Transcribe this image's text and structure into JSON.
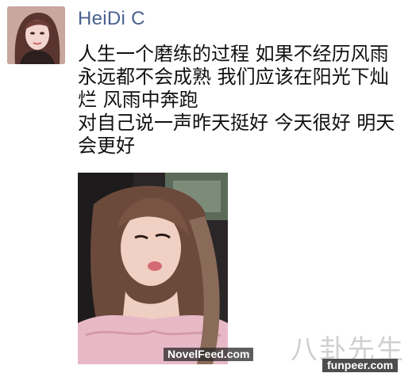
{
  "post": {
    "author": "HeiDi C",
    "text_lines": [
      "人生一个磨练的过程  如果不经历风雨",
      "永远都不会成熟  我们应该在阳光下灿",
      "烂  风雨中奔跑",
      "对自己说一声昨天挺好 今天很好 明天",
      "会更好"
    ]
  },
  "watermarks": {
    "novelfeed": "NovelFeed.com",
    "bagua": "八卦先生",
    "funpeer": "funpeer.com"
  },
  "colors": {
    "author_name": "#4a6190",
    "text": "#111111",
    "background": "#ffffff"
  },
  "icons": {
    "avatar": "profile-photo",
    "photo": "selfie-photo"
  }
}
